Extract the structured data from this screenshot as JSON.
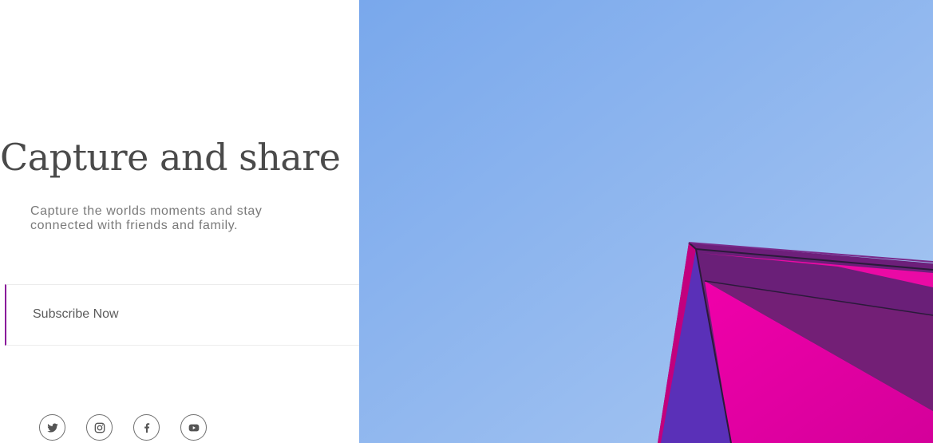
{
  "hero": {
    "title": "Capture and share",
    "subtitle": "Capture the worlds moments and stay connected with friends and family."
  },
  "cta": {
    "subscribe_label": "Subscribe Now",
    "accent_color": "#8a1a9b"
  },
  "social": {
    "icons": [
      "twitter-icon",
      "instagram-icon",
      "facebook-icon",
      "youtube-icon"
    ]
  },
  "image": {
    "subject": "magenta-building-corner-against-blue-sky",
    "sky_color": "#8fb7ec",
    "building_color": "#e0049f"
  }
}
